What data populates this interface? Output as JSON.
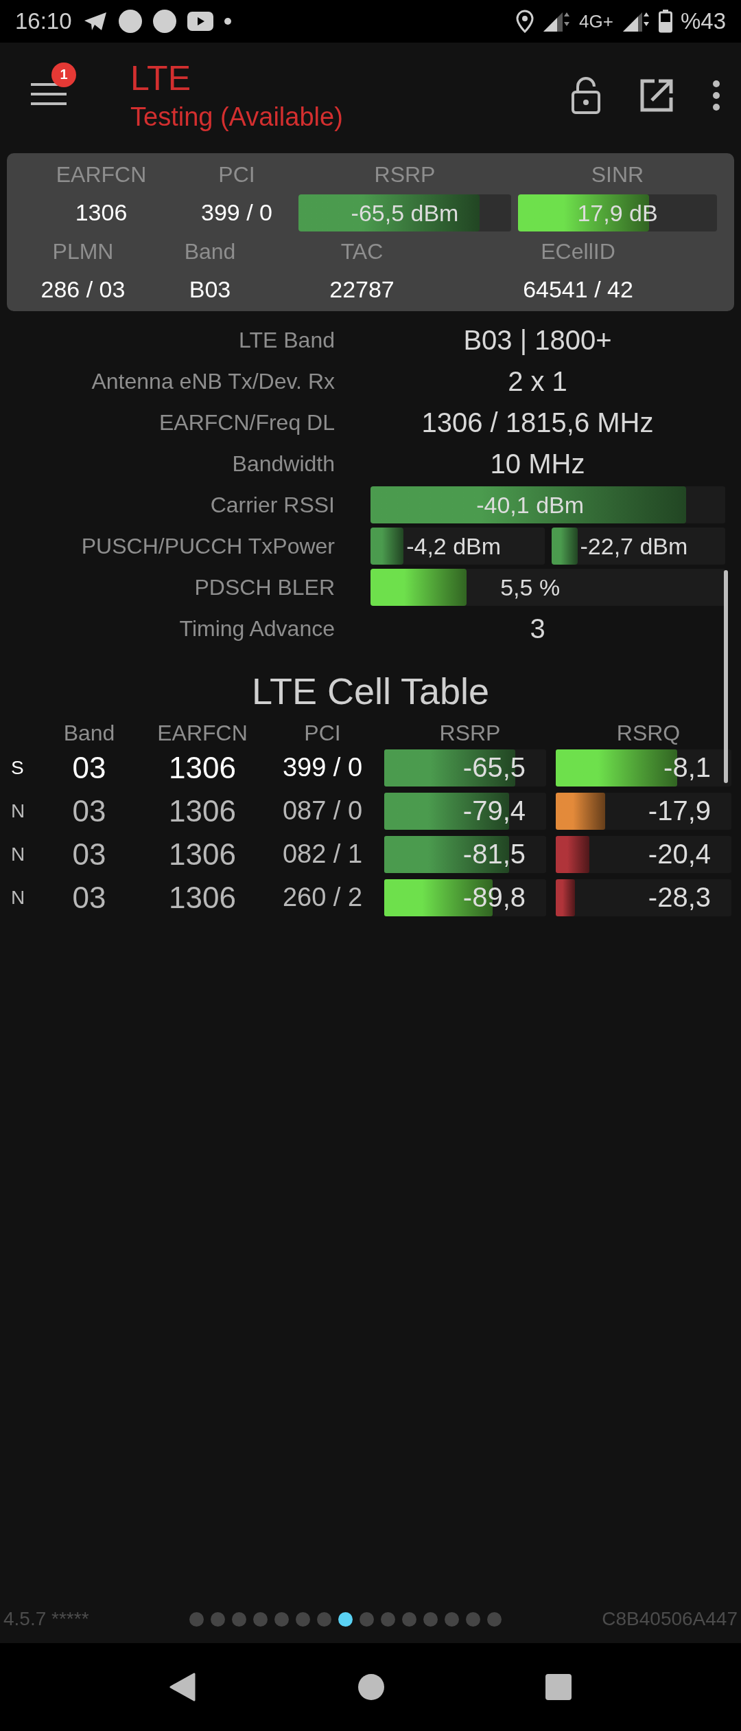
{
  "status_bar": {
    "time": "16:10",
    "network": "4G+",
    "battery": "%43"
  },
  "toolbar": {
    "notification_count": "1",
    "title": "LTE",
    "subtitle": "Testing (Available)"
  },
  "summary": {
    "top_row": [
      {
        "label": "EARFCN",
        "kind": "text",
        "value": "1306"
      },
      {
        "label": "PCI",
        "kind": "text",
        "value": "399 / 0"
      },
      {
        "label": "RSRP",
        "kind": "bar",
        "value": "-65,5 dBm",
        "level": 0.85,
        "color": "#4b9b4e"
      },
      {
        "label": "SINR",
        "kind": "bar",
        "value": "17,9 dB",
        "level": 0.66,
        "color": "#6ee04c"
      }
    ],
    "bottom_row": [
      {
        "label": "PLMN",
        "kind": "text",
        "value": "286 / 03"
      },
      {
        "label": "Band",
        "kind": "text",
        "value": "B03"
      },
      {
        "label": "TAC",
        "kind": "text",
        "value": "22787"
      },
      {
        "label": "ECellID",
        "kind": "text",
        "value": "64541 / 42"
      }
    ]
  },
  "details": [
    {
      "label": "LTE Band",
      "kind": "text",
      "value": "B03 | 1800+"
    },
    {
      "label": "Antenna eNB Tx/Dev. Rx",
      "kind": "text",
      "value": "2 x 1"
    },
    {
      "label": "EARFCN/Freq DL",
      "kind": "text",
      "value": "1306 / 1815,6 MHz"
    },
    {
      "label": "Bandwidth",
      "kind": "text",
      "value": "10 MHz"
    },
    {
      "label": "Carrier RSSI",
      "kind": "bar",
      "bars": [
        {
          "value": "-40,1 dBm",
          "level": 0.89,
          "color": "#4b9b4e"
        }
      ]
    },
    {
      "label": "PUSCH/PUCCH TxPower",
      "kind": "dual_bar",
      "bars": [
        {
          "value": "-4,2 dBm",
          "level": 0.19,
          "color": "#4b9b4e"
        },
        {
          "value": "-22,7 dBm",
          "level": 0.15,
          "color": "#4b9b4e"
        }
      ]
    },
    {
      "label": "PDSCH BLER",
      "kind": "bar",
      "bars": [
        {
          "value": "5,5 %",
          "level": 0.27,
          "color": "#6ee04c"
        }
      ]
    },
    {
      "label": "Timing Advance",
      "kind": "text",
      "value": "3"
    }
  ],
  "cell_table": {
    "title": "LTE Cell Table",
    "columns": [
      "Band",
      "EARFCN",
      "PCI",
      "RSRP",
      "RSRQ"
    ],
    "rows": [
      {
        "type": "S",
        "highlighted": true,
        "band": "03",
        "earfcn": "1306",
        "pci": "399 / 0",
        "rsrp": {
          "value": "-65,5",
          "level": 0.81,
          "color": "#4b9b4e"
        },
        "rsrq": {
          "value": "-8,1",
          "level": 0.69,
          "color": "#6ee04c"
        }
      },
      {
        "type": "N",
        "highlighted": false,
        "band": "03",
        "earfcn": "1306",
        "pci": "087 / 0",
        "rsrp": {
          "value": "-79,4",
          "level": 0.77,
          "color": "#4b9b4e"
        },
        "rsrq": {
          "value": "-17,9",
          "level": 0.28,
          "color": "#e38a3a"
        }
      },
      {
        "type": "N",
        "highlighted": false,
        "band": "03",
        "earfcn": "1306",
        "pci": "082 / 1",
        "rsrp": {
          "value": "-81,5",
          "level": 0.77,
          "color": "#4b9b4e"
        },
        "rsrq": {
          "value": "-20,4",
          "level": 0.19,
          "color": "#b0343a"
        }
      },
      {
        "type": "N",
        "highlighted": false,
        "band": "03",
        "earfcn": "1306",
        "pci": "260 / 2",
        "rsrp": {
          "value": "-89,8",
          "level": 0.67,
          "color": "#6ee04c"
        },
        "rsrq": {
          "value": "-28,3",
          "level": 0.11,
          "color": "#b0343a"
        }
      }
    ]
  },
  "footer": {
    "version": "4.5.7 *****",
    "pager": [
      {
        "selected": false
      },
      {
        "selected": false
      },
      {
        "selected": false
      },
      {
        "selected": false
      },
      {
        "selected": false
      },
      {
        "selected": false
      },
      {
        "selected": false
      },
      {
        "selected": true
      },
      {
        "selected": false
      },
      {
        "selected": false
      },
      {
        "selected": false
      },
      {
        "selected": false
      },
      {
        "selected": false
      },
      {
        "selected": false
      },
      {
        "selected": false
      }
    ],
    "device_id": "C8B40506A447"
  }
}
